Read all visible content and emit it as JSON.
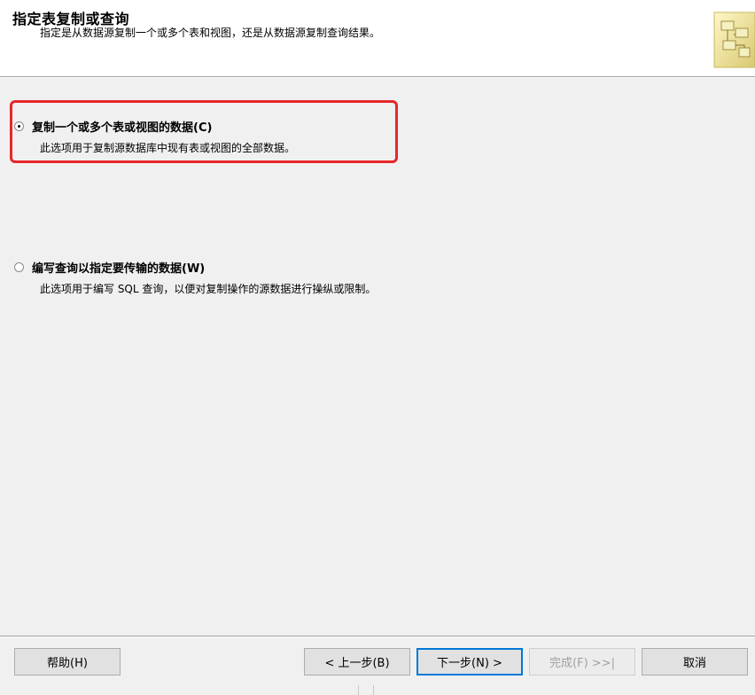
{
  "header": {
    "title": "指定表复制或查询",
    "subtitle": "指定是从数据源复制一个或多个表和视图，还是从数据源复制查询结果。",
    "icon": "wizard-table-icon"
  },
  "options": [
    {
      "label": "复制一个或多个表或视图的数据(C)",
      "description": "此选项用于复制源数据库中现有表或视图的全部数据。",
      "checked": true
    },
    {
      "label": "编写查询以指定要传输的数据(W)",
      "description": "此选项用于编写 SQL 查询，以便对复制操作的源数据进行操纵或限制。",
      "checked": false
    }
  ],
  "buttons": {
    "help": "帮助(H)",
    "back": "< 上一步(B)",
    "next": "下一步(N) >",
    "finish": "完成(F) >>|",
    "cancel": "取消"
  },
  "colors": {
    "highlight": "#e8262a",
    "default_button_border": "#0078d7"
  }
}
